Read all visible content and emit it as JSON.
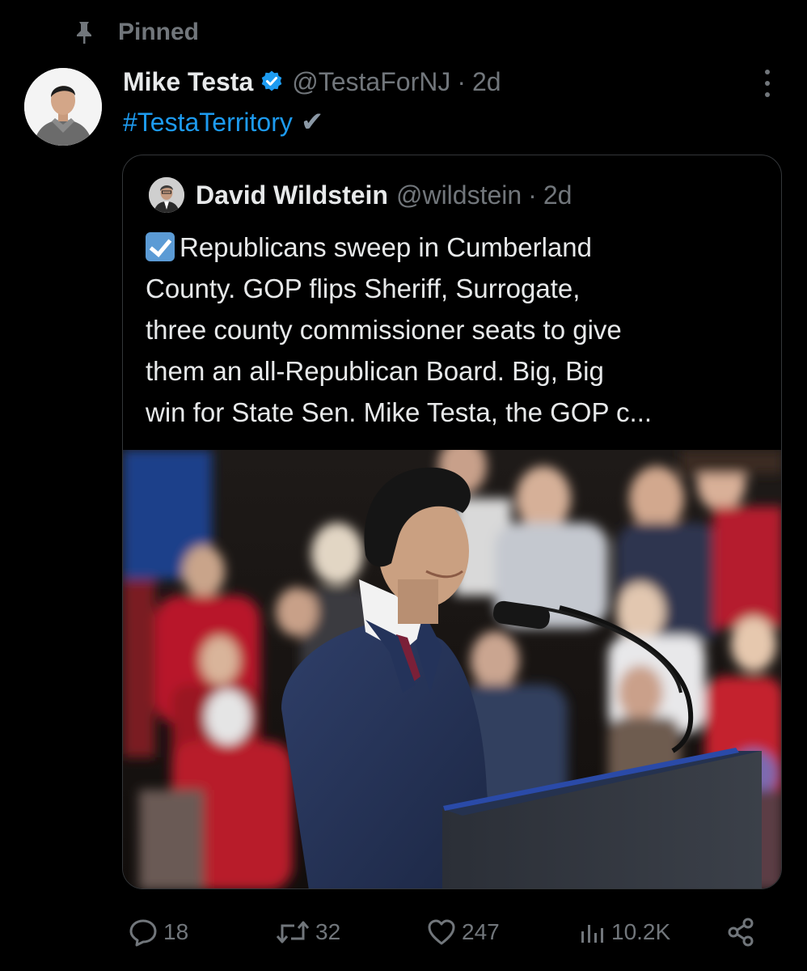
{
  "pinned": {
    "label": "Pinned"
  },
  "post": {
    "author_name": "Mike Testa",
    "handle": "@TestaForNJ",
    "separator": "·",
    "time": "2d",
    "hashtag": "#TestaTerritory",
    "check": "✔"
  },
  "quote": {
    "author_name": "David Wildstein",
    "handle": "@wildstein",
    "separator": "·",
    "time": "2d",
    "lines": [
      "Republicans sweep in Cumberland",
      "County.  GOP flips Sheriff, Surrogate,",
      "three county commissioner seats to give",
      "them an all-Republican Board.  Big, Big",
      "win for State Sen. Mike Testa, the GOP c..."
    ]
  },
  "actions": {
    "replies": "18",
    "reposts": "32",
    "likes": "247",
    "views": "10.2K"
  },
  "colors": {
    "background": "#000000",
    "text": "#e7e9ea",
    "muted": "#71767b",
    "link": "#1d9bf0",
    "border": "#333639",
    "verified": "#1d9bf0"
  },
  "icons": [
    "pin-icon",
    "verified-badge-icon",
    "more-icon",
    "reply-icon",
    "repost-icon",
    "like-icon",
    "views-icon",
    "share-icon"
  ]
}
